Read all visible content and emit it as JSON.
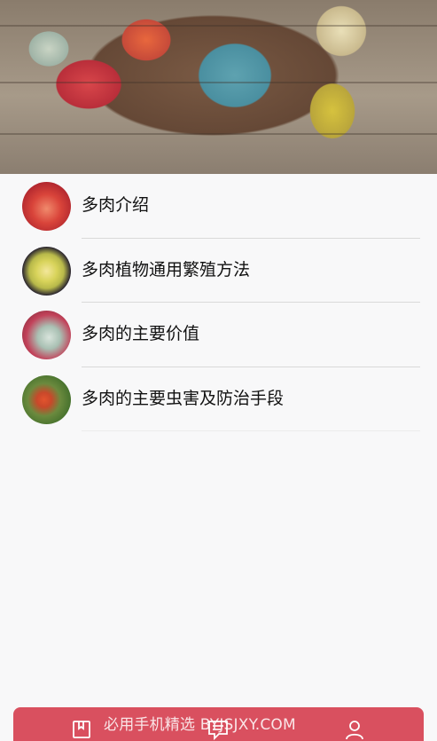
{
  "hero": {
    "icon": "succulent-arrangement-photo"
  },
  "items": [
    {
      "label": "多肉介绍",
      "thumb": "red-succulent-thumb"
    },
    {
      "label": "多肉植物通用繁殖方法",
      "thumb": "yellow-succulent-thumb"
    },
    {
      "label": "多肉的主要价值",
      "thumb": "pink-succulent-thumb"
    },
    {
      "label": "多肉的主要虫害及防治手段",
      "thumb": "pest-on-leaf-thumb"
    }
  ],
  "tabbar": {
    "color": "#d9505f",
    "tabs": [
      {
        "icon": "book-icon"
      },
      {
        "icon": "chat-icon"
      },
      {
        "icon": "person-icon"
      }
    ]
  },
  "watermark": "必用手机精选 BYJSJXY.COM"
}
